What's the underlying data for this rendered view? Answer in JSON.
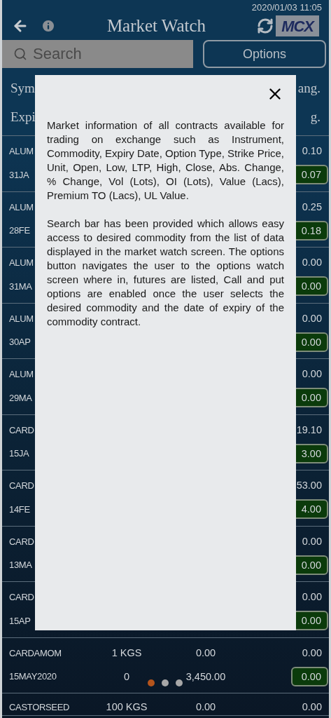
{
  "status_bar": {
    "time": "2020/01/03 11:05"
  },
  "header": {
    "title": "Market Watch",
    "logo": "MCX"
  },
  "search": {
    "placeholder": "Search"
  },
  "options_button": "Options",
  "columns": [
    [
      "Sym",
      "Expi"
    ],
    [],
    [],
    [
      "ang.",
      "g."
    ]
  ],
  "rows": [
    {
      "symbol": "ALUM",
      "abs_change": "0.10",
      "expiry": "31JA",
      "pct_change": "0.07"
    },
    {
      "symbol": "ALUM",
      "abs_change": "0.25",
      "expiry": "28FE",
      "pct_change": "0.18"
    },
    {
      "symbol": "ALUM",
      "abs_change": "0.00",
      "expiry": "31MA",
      "pct_change": "0.00"
    },
    {
      "symbol": "ALUM",
      "abs_change": "0.00",
      "expiry": "30AP",
      "pct_change": "0.00"
    },
    {
      "symbol": "ALUM",
      "abs_change": "0.00",
      "expiry": "29MA",
      "pct_change": "0.00"
    },
    {
      "symbol": "CARD",
      "abs_change": "19.10",
      "expiry": "15JA",
      "pct_change": "3.00"
    },
    {
      "symbol": "CARD",
      "abs_change": "53.00",
      "expiry": "14FE",
      "pct_change": "4.00"
    },
    {
      "symbol": "CARD",
      "abs_change": "0.00",
      "expiry": "13MA",
      "pct_change": "0.00"
    },
    {
      "symbol": "CARD",
      "abs_change": "0.00",
      "expiry": "15AP",
      "pct_change": "0.00"
    },
    {
      "symbol": "CARDAMOM",
      "unit": "1 KGS",
      "ltp": "0.00",
      "abs_change": "0.00",
      "expiry": "15MAY2020",
      "oi": "0",
      "p_close": "3,450.00",
      "pct_change": "0.00"
    },
    {
      "symbol": "CASTORSEED",
      "unit": "100 KGS",
      "ltp": "0.00",
      "abs_change": "0.00"
    }
  ],
  "dialog": {
    "paragraphs": [
      "Market information of all contracts available for trading on exchange such as Instrument, Commodity, Expiry Date, Option Type, Strike Price, Unit, Open, Low, LTP, High, Close, Abs. Change, % Change, Vol (Lots), OI (Lots), Value (Lacs), Premium TO (Lacs), UL Value.",
      "Search bar has been provided which allows easy access to desired commodity from the list of data displayed in the market watch screen. The options button navigates the user to the options watch screen where in, futures are listed, Call and put options are enabled once the user selects the desired commodity and the date of expiry of the commodity contract."
    ]
  },
  "pager": [
    {
      "selected": true
    },
    {
      "selected": false
    },
    {
      "selected": false
    }
  ]
}
